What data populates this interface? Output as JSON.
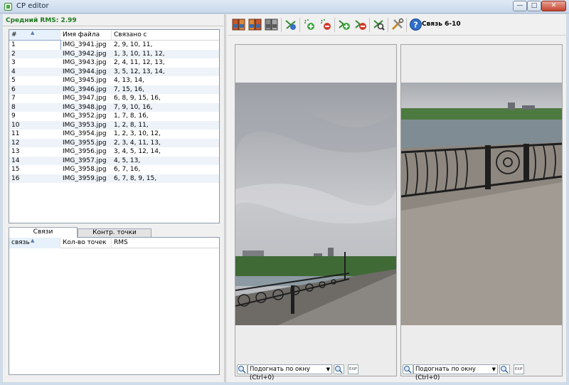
{
  "window": {
    "title": "CP editor",
    "minimize_glyph": "—",
    "maximize_glyph": "□",
    "close_glyph": "✕"
  },
  "left": {
    "rms_label": "Средний RMS: 2.99",
    "files_table": {
      "headers": [
        "#",
        "Имя файла",
        "Связано с"
      ],
      "rows": [
        [
          "1",
          "IMG_3941.jpg",
          "2, 9, 10, 11,"
        ],
        [
          "2",
          "IMG_3942.jpg",
          "1, 3, 10, 11, 12,"
        ],
        [
          "3",
          "IMG_3943.jpg",
          "2, 4, 11, 12, 13,"
        ],
        [
          "4",
          "IMG_3944.jpg",
          "3, 5, 12, 13, 14,"
        ],
        [
          "5",
          "IMG_3945.jpg",
          "4, 13, 14,"
        ],
        [
          "6",
          "IMG_3946.jpg",
          "7, 15, 16,"
        ],
        [
          "7",
          "IMG_3947.jpg",
          "6, 8, 9, 15, 16,"
        ],
        [
          "8",
          "IMG_3948.jpg",
          "7, 9, 10, 16,"
        ],
        [
          "9",
          "IMG_3952.jpg",
          "1, 7, 8, 16,"
        ],
        [
          "10",
          "IMG_3953.jpg",
          "1, 2, 8, 11,"
        ],
        [
          "11",
          "IMG_3954.jpg",
          "1, 2, 3, 10, 12,"
        ],
        [
          "12",
          "IMG_3955.jpg",
          "2, 3, 4, 11, 13,"
        ],
        [
          "13",
          "IMG_3956.jpg",
          "3, 4, 5, 12, 14,"
        ],
        [
          "14",
          "IMG_3957.jpg",
          "4, 5, 13,"
        ],
        [
          "15",
          "IMG_3958.jpg",
          "6, 7, 16,"
        ],
        [
          "16",
          "IMG_3959.jpg",
          "6, 7, 8, 9, 15,"
        ]
      ]
    },
    "tabs": [
      "Связи",
      "Контр. точки"
    ],
    "links_table": {
      "headers": [
        "связь",
        "Кол-во точек",
        "RMS"
      ]
    }
  },
  "right": {
    "toolbar": {
      "icons": [
        "image-pair-icon",
        "image-pair-swap-icon",
        "image-pair-gray-icon",
        "add-link-icon",
        "add-point-icon",
        "delete-point-icon",
        "add-link-plus-icon",
        "remove-link-icon",
        "find-points-icon",
        "tools-icon",
        "help-icon"
      ],
      "link_title": "Связь 6-10"
    },
    "viewers": [
      {
        "zoom_select": "Подогнать по окну (Ctrl+0)",
        "exif_label": "EXIF"
      },
      {
        "zoom_select": "Подогнать по окну (Ctrl+0)",
        "exif_label": "EXIF"
      }
    ]
  },
  "colors": {
    "rms_green": "#1f7a1f",
    "window_frame": "#cfdbe8",
    "selection_blue": "#e6f1fb"
  }
}
